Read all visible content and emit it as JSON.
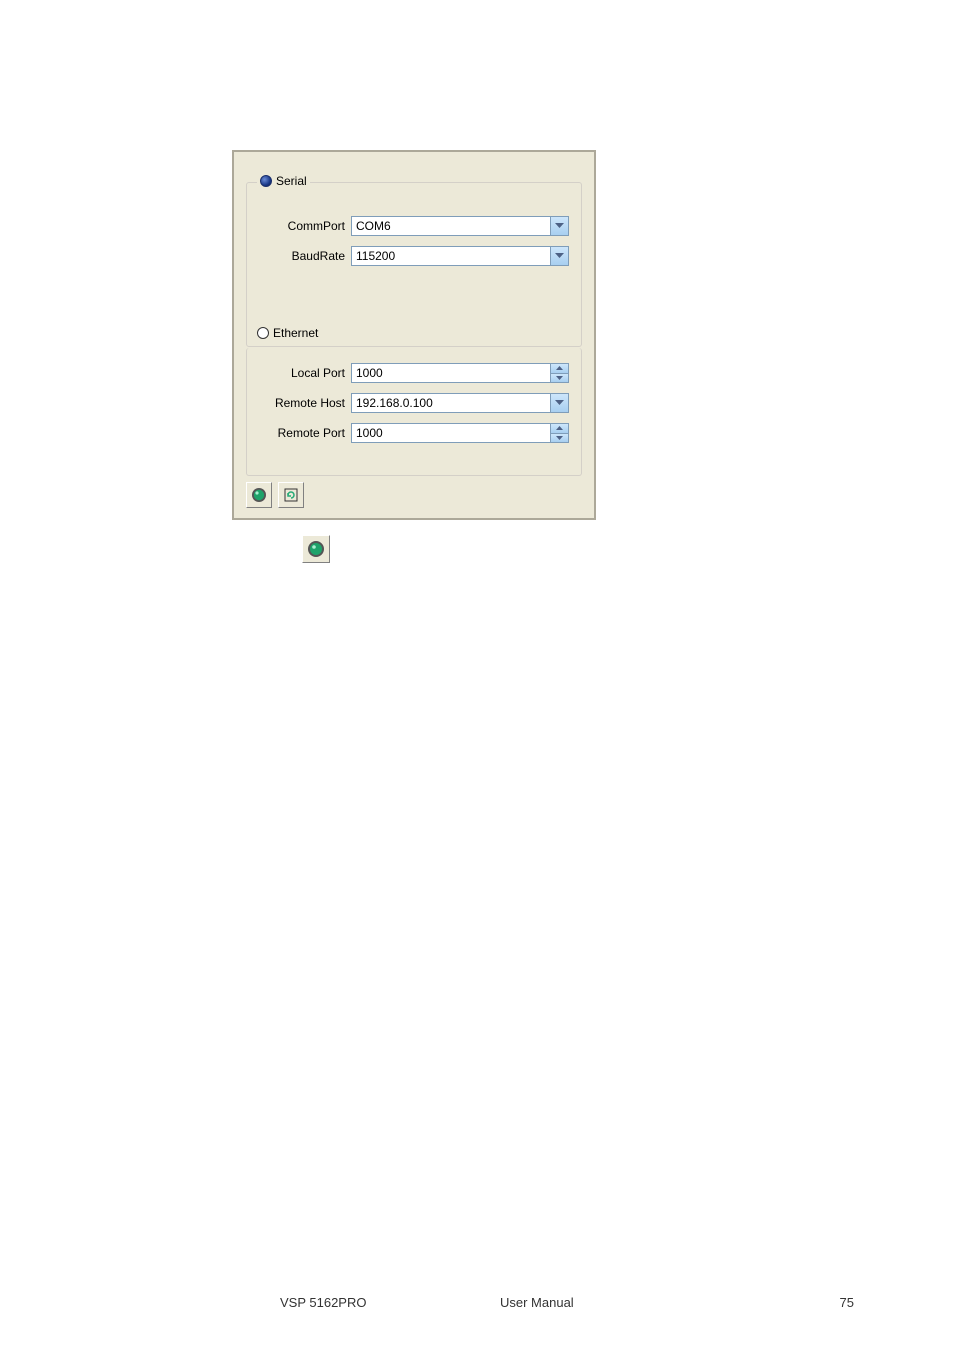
{
  "panel": {
    "serial": {
      "title": "Serial",
      "commport_label": "CommPort",
      "commport_value": "COM6",
      "baudrate_label": "BaudRate",
      "baudrate_value": "115200"
    },
    "ethernet": {
      "title": "Ethernet",
      "localport_label": "Local Port",
      "localport_value": "1000",
      "remotehost_label": "Remote Host",
      "remotehost_value": "192.168.0.100",
      "remoteport_label": "Remote Port",
      "remoteport_value": "1000"
    }
  },
  "footer": {
    "left": "VSP 5162PRO",
    "center": "User Manual",
    "right": "75"
  }
}
